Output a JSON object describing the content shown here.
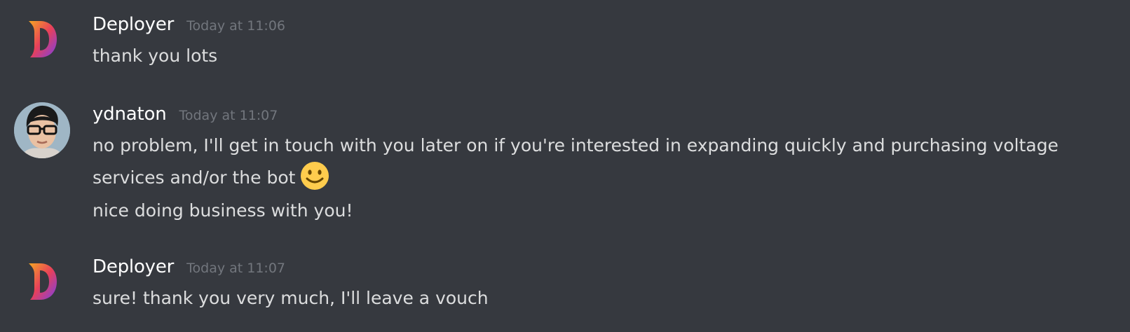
{
  "messages": [
    {
      "author": "Deployer",
      "timestamp": "Today at 11:06",
      "avatar_icon": "deployer-logo-icon",
      "lines": [
        "thank you lots"
      ]
    },
    {
      "author": "ydnaton",
      "timestamp": "Today at 11:07",
      "avatar_icon": "user-avatar-photo",
      "lines": [
        "no problem, I'll get in touch with you later on if you're interested in expanding quickly and purchasing voltage",
        "services and/or the bot",
        "nice doing business with you!"
      ],
      "emoji": "slightly-smiling-face-icon"
    },
    {
      "author": "Deployer",
      "timestamp": "Today at 11:07",
      "avatar_icon": "deployer-logo-icon",
      "lines": [
        "sure! thank you very much, I'll leave a vouch"
      ]
    }
  ],
  "colors": {
    "background": "#36393f",
    "username": "#ffffff",
    "timestamp": "#72767d",
    "message_text": "#dcddde"
  }
}
